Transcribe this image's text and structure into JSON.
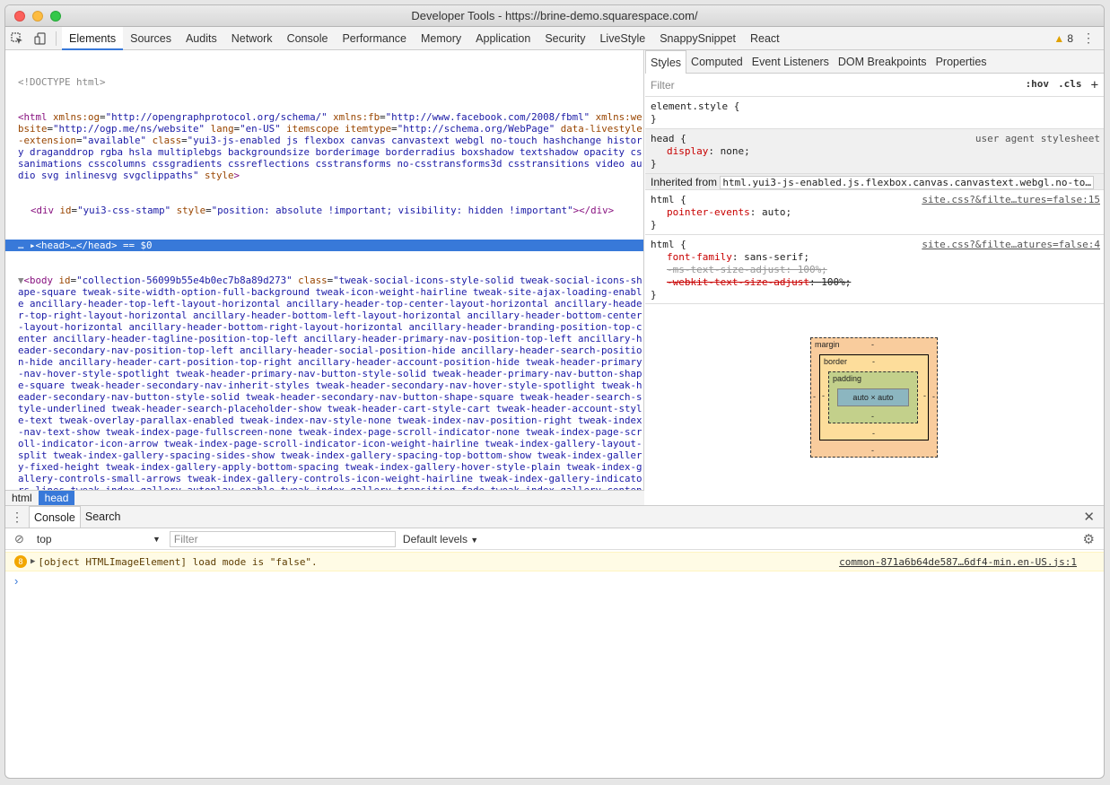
{
  "window": {
    "title": "Developer Tools - https://brine-demo.squarespace.com/"
  },
  "toolbar": {
    "tabs": [
      "Elements",
      "Sources",
      "Audits",
      "Network",
      "Console",
      "Performance",
      "Memory",
      "Application",
      "Security",
      "LiveStyle",
      "SnappySnippet",
      "React"
    ],
    "active_tab": "Elements",
    "warnings_count": "8"
  },
  "elements": {
    "doctype": "<!DOCTYPE html>",
    "html_tag": "<html",
    "html_attrs": [
      {
        "name": "xmlns:og",
        "value": "\"http://opengraphprotocol.org/schema/\""
      },
      {
        "name": "xmlns:fb",
        "value": "\"http://www.facebook.com/2008/fbml\""
      },
      {
        "name": "xmlns:website",
        "value": "\"http://ogp.me/ns/website\""
      },
      {
        "name": "lang",
        "value": "\"en-US\""
      },
      {
        "name": "itemscope",
        "value": ""
      },
      {
        "name": "itemtype",
        "value": "\"http://schema.org/WebPage\""
      },
      {
        "name": "data-livestyle-extension",
        "value": "\"available\""
      },
      {
        "name": "class",
        "value": "\"yui3-js-enabled js flexbox canvas canvastext webgl no-touch hashchange history draganddrop rgba hsla multiplebgs backgroundsize borderimage borderradius boxshadow textshadow opacity cssanimations csscolumns cssgradients cssreflections csstransforms no-csstransforms3d csstransitions video audio svg inlinesvg svgclippaths\""
      },
      {
        "name": "style",
        "value": ""
      }
    ],
    "div_line": {
      "open": "<div",
      "id_attr": "id",
      "id_val": "\"yui3-css-stamp\"",
      "style_attr": "style",
      "style_val": "\"position: absolute !important; visibility: hidden !important\"",
      "close": "></div>"
    },
    "head_line": {
      "text": "<head>…</head>",
      "marker": "== $0"
    },
    "body_open": "<body",
    "body_id_attr": "id",
    "body_id_val": "\"collection-56099b55e4b0ec7b8a89d273\"",
    "body_class_attr": "class",
    "body_class_val": "\"tweak-social-icons-style-solid tweak-social-icons-shape-square tweak-site-width-option-full-background tweak-icon-weight-hairline tweak-site-ajax-loading-enable ancillary-header-top-left-layout-horizontal ancillary-header-top-center-layout-horizontal ancillary-header-top-right-layout-horizontal ancillary-header-bottom-left-layout-horizontal ancillary-header-bottom-center-layout-horizontal ancillary-header-bottom-right-layout-horizontal ancillary-header-branding-position-top-center ancillary-header-tagline-position-top-left ancillary-header-primary-nav-position-top-left ancillary-header-secondary-nav-position-top-left ancillary-header-social-position-hide ancillary-header-search-position-hide ancillary-header-cart-position-top-right ancillary-header-account-position-hide tweak-header-primary-nav-hover-style-spotlight tweak-header-primary-nav-button-style-solid tweak-header-primary-nav-button-shape-square tweak-header-secondary-nav-inherit-styles tweak-header-secondary-nav-hover-style-spotlight tweak-header-secondary-nav-button-style-solid tweak-header-secondary-nav-button-shape-square tweak-header-search-style-underlined tweak-header-search-placeholder-show tweak-header-cart-style-cart tweak-header-account-style-text tweak-overlay-parallax-enabled tweak-index-nav-style-none tweak-index-nav-position-right tweak-index-nav-text-show tweak-index-page-fullscreen-none tweak-index-page-scroll-indicator-none tweak-index-page-scroll-indicator-icon-arrow tweak-index-page-scroll-indicator-icon-weight-hairline tweak-index-gallery-layout-split tweak-index-gallery-spacing-sides-show tweak-index-gallery-spacing-top-bottom-show tweak-index-gallery-fixed-height tweak-index-gallery-apply-bottom-spacing tweak-index-gallery-hover-style-plain tweak-index-gallery-controls-small-arrows tweak-index-gallery-controls-icon-weight-hairline tweak-index-gallery-indicators-lines tweak-index-gallery-autoplay-enable tweak-index-gallery-transition-fade tweak-index-gallery-content-position-bottom-center tweak-index-gallery-content-text-alignment-center tweak-footer-show tweak-footer-layout-stacked tweak-footer-layout-columns-auto tweak-footer-stacked-alignment-center ancillary-mobile-bar-branding-position-top-left ancillary-mobile-bar-menu-icon-position-top-right tweak-mobile-bar-menu-icon-hamburger ancillary-mobile-bar-search-icon-position-top-right ancillary-mobile-bar-cart-position-bottom-center tweak-mobile-bar-cart-style-cart ancillary-mobile-bar-account-position-hide tweak-mobile-bar-account-style-text tweak-mobile-overlay-slide-origin-left tweak-mobile-overlay-close-show tweak-mobile-overlay-menu-primary-button-style-solid tweak-mobile-overlay-menu-primary-button-shape-square tweak-mobile-overlay-menu-secondary-button-style-solid tweak-mobile-overlay-menu-secondary-button-shape-square tweak-"
  },
  "breadcrumbs": [
    "html",
    "head"
  ],
  "styles": {
    "tabs": [
      "Styles",
      "Computed",
      "Event Listeners",
      "DOM Breakpoints",
      "Properties"
    ],
    "filter_placeholder": "Filter",
    "hov": ":hov",
    "cls": ".cls",
    "add": "+",
    "element_style": "element.style {",
    "close_brace": "}",
    "ua_rule": {
      "selector": "head {",
      "source": "user agent stylesheet",
      "prop": "display",
      "val": "none;"
    },
    "inherited_label": "Inherited from",
    "inherited_selector": "html.yui3-js-enabled.js.flexbox.canvas.canvastext.webgl.no-to…",
    "rule1": {
      "selector": "html {",
      "source": "site.css?&filte…tures=false:15",
      "prop": "pointer-events",
      "val": "auto;"
    },
    "rule2": {
      "selector": "html {",
      "source": "site.css?&filte…atures=false:4",
      "prop1": "font-family",
      "val1": "sans-serif;",
      "prop2": "-ms-text-size-adjust: 100%;",
      "prop3": "-webkit-text-size-adjust",
      "val3": "100%;"
    },
    "boxmodel": {
      "margin": "margin",
      "border": "border",
      "padding": "padding",
      "content": "auto × auto",
      "dash": "-"
    }
  },
  "console": {
    "tabs": [
      "Console",
      "Search"
    ],
    "context": "top",
    "filter_placeholder": "Filter",
    "levels": "Default levels",
    "message": {
      "count": "8",
      "text": "[object HTMLImageElement] load mode is \"false\".",
      "source": "common-871a6b64de587…6df4-min.en-US.js:1"
    },
    "prompt": "›"
  }
}
